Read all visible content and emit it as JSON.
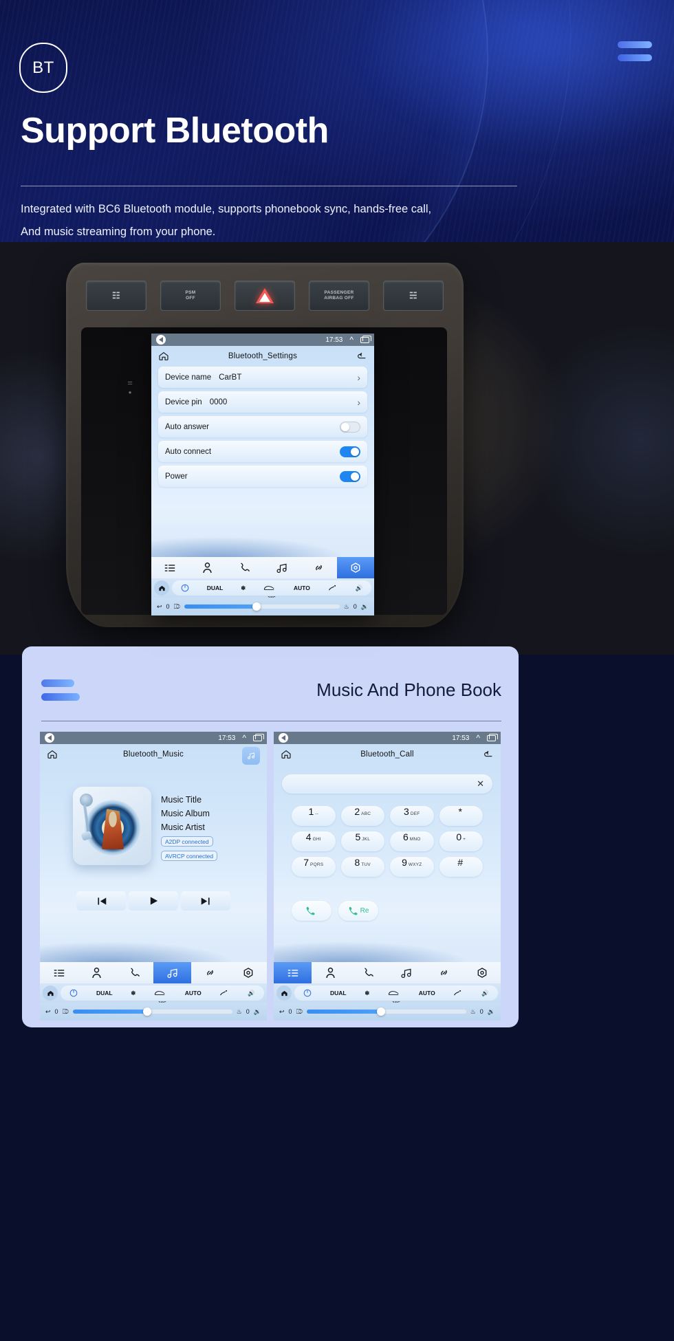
{
  "hero": {
    "badge": "BT",
    "title": "Support Bluetooth",
    "subtitle_line1": "Integrated with BC6 Bluetooth module, supports phonebook sync, hands-free call,",
    "subtitle_line2": "And music streaming from your phone.",
    "accent_color": "#4f7ae8",
    "background_color": "#0d1449"
  },
  "dashboard_buttons": [
    {
      "label": "",
      "icon": "seat-heater-icon"
    },
    {
      "label": "PSM\nOFF",
      "icon": "psm-off-icon"
    },
    {
      "label": "",
      "icon": "hazard-warning-icon"
    },
    {
      "label": "PASSENGER\nAIRBAG OFF",
      "icon": "airbag-icon"
    },
    {
      "label": "",
      "icon": "seat-control-icon"
    }
  ],
  "settings_screen": {
    "status": {
      "time": "17:53",
      "volume_icon": "volume-icon",
      "chevron_icon": "chevron-up-icon",
      "window_icon": "recents-icon"
    },
    "title": "Bluetooth_Settings",
    "home_icon": "home-icon",
    "back_icon": "back-arrow-icon",
    "rows": [
      {
        "label": "Device name",
        "value": "CarBT",
        "control": "chevron",
        "state": ""
      },
      {
        "label": "Device pin",
        "value": "0000",
        "control": "chevron",
        "state": ""
      },
      {
        "label": "Auto answer",
        "value": "",
        "control": "toggle",
        "state": "off"
      },
      {
        "label": "Auto connect",
        "value": "",
        "control": "toggle",
        "state": "on"
      },
      {
        "label": "Power",
        "value": "",
        "control": "toggle",
        "state": "on"
      }
    ],
    "appbar": [
      {
        "icon": "keypad-icon",
        "active": false
      },
      {
        "icon": "contact-icon",
        "active": false
      },
      {
        "icon": "phone-icon",
        "active": false
      },
      {
        "icon": "music-icon",
        "active": false
      },
      {
        "icon": "link-icon",
        "active": false
      },
      {
        "icon": "settings-icon",
        "active": true
      }
    ],
    "hvac": {
      "home_icon": "home-icon",
      "power_icon": "power-icon",
      "dual_label": "DUAL",
      "snowflake_icon": "snowflake-icon",
      "defrost_icon": "rear-defrost-icon",
      "auto_label": "AUTO",
      "airflow_icon": "airflow-icon",
      "volume_up_icon": "volume-up-icon",
      "temperature": "24°C"
    },
    "bottom": {
      "back_icon": "back-icon",
      "left_value": "0",
      "seat_icon": "seat-icon",
      "fan_icon": "fan-icon",
      "heater_icon": "seat-heater-icon",
      "right_value": "0",
      "volume_down_icon": "volume-down-icon"
    }
  },
  "lower_card": {
    "title": "Music And Phone Book",
    "background_color": "#ccd6f8"
  },
  "music_screen": {
    "status": {
      "time": "17:53"
    },
    "title": "Bluetooth_Music",
    "home_icon": "home-icon",
    "back_icon": "back-arrow-icon",
    "music_chip_icon": "music-note-icon",
    "album_art_icon": "vinyl-record-icon",
    "info": {
      "title": "Music Title",
      "album": "Music Album",
      "artist": "Music Artist"
    },
    "badges": [
      "A2DP  connected",
      "AVRCP connected"
    ],
    "controls": [
      {
        "icon": "previous-track-icon"
      },
      {
        "icon": "play-icon"
      },
      {
        "icon": "next-track-icon"
      }
    ],
    "appbar": [
      {
        "icon": "keypad-icon",
        "active": false
      },
      {
        "icon": "contact-icon",
        "active": false
      },
      {
        "icon": "phone-icon",
        "active": false
      },
      {
        "icon": "music-icon",
        "active": true
      },
      {
        "icon": "link-icon",
        "active": false
      },
      {
        "icon": "settings-icon",
        "active": false
      }
    ]
  },
  "call_screen": {
    "status": {
      "time": "17:53"
    },
    "title": "Bluetooth_Call",
    "home_icon": "home-icon",
    "back_icon": "back-arrow-icon",
    "input_value": "",
    "clear_icon": "close-icon",
    "keypad": [
      {
        "num": "1",
        "sub": "--"
      },
      {
        "num": "2",
        "sub": "ABC"
      },
      {
        "num": "3",
        "sub": "DEF"
      },
      {
        "num": "*",
        "sub": ""
      },
      {
        "num": "4",
        "sub": "GHI"
      },
      {
        "num": "5",
        "sub": "JKL"
      },
      {
        "num": "6",
        "sub": "MNO"
      },
      {
        "num": "0",
        "sub": "+"
      },
      {
        "num": "7",
        "sub": "PQRS"
      },
      {
        "num": "8",
        "sub": "TUV"
      },
      {
        "num": "9",
        "sub": "WXYZ"
      },
      {
        "num": "#",
        "sub": ""
      }
    ],
    "call_buttons": [
      {
        "label": "",
        "icon": "call-icon"
      },
      {
        "label": "Re",
        "icon": "redial-icon"
      }
    ],
    "appbar": [
      {
        "icon": "keypad-icon",
        "active": true
      },
      {
        "icon": "contact-icon",
        "active": false
      },
      {
        "icon": "phone-icon",
        "active": false
      },
      {
        "icon": "music-icon",
        "active": false
      },
      {
        "icon": "link-icon",
        "active": false
      },
      {
        "icon": "settings-icon",
        "active": false
      }
    ]
  },
  "hvac_common": {
    "dual_label": "DUAL",
    "auto_label": "AUTO",
    "temperature": "24°C",
    "left_value": "0",
    "right_value": "0"
  }
}
